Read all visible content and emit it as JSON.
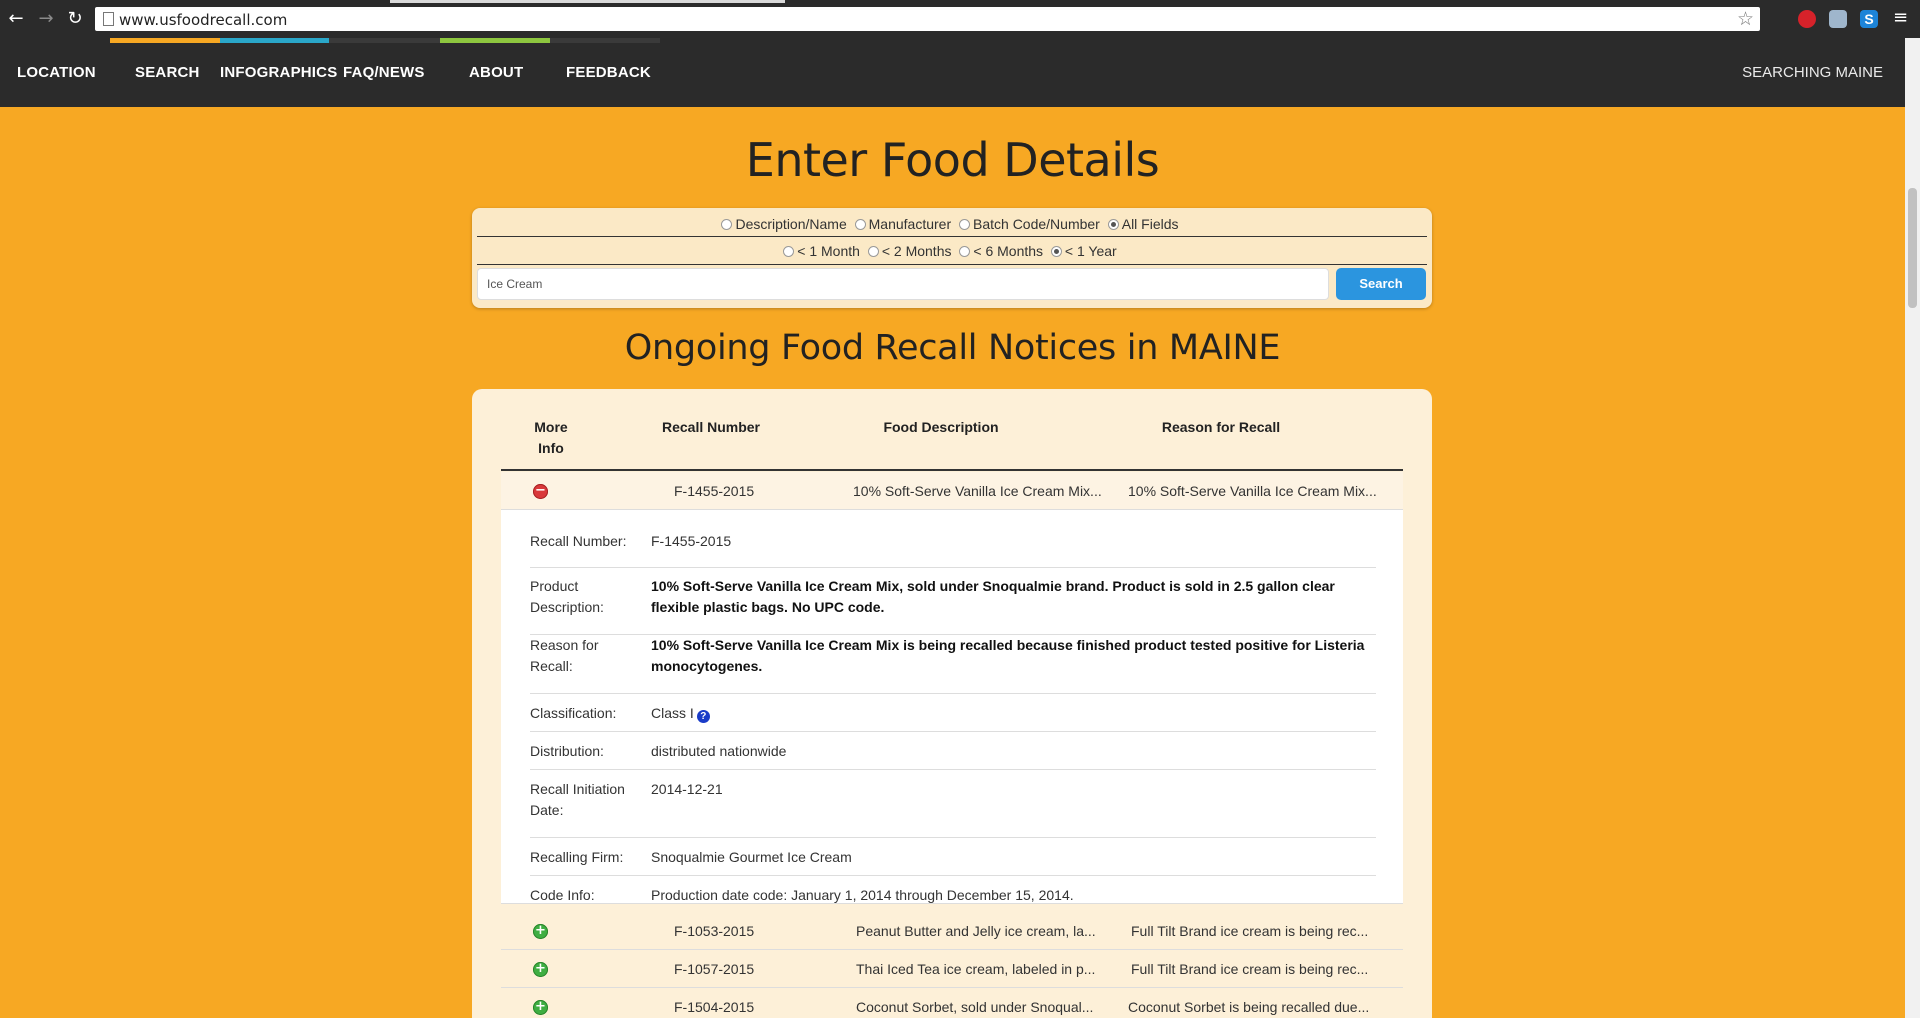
{
  "browser": {
    "url": "www.usfoodrecall.com",
    "back_icon": "back-arrow-icon",
    "forward_icon": "forward-arrow-icon",
    "reload_icon": "reload-icon",
    "star_icon": "bookmark-star-icon",
    "menu_icon": "menu-icon",
    "ext_s_label": "S"
  },
  "nav": {
    "items": [
      {
        "label": "LOCATION",
        "accent": ""
      },
      {
        "label": "SEARCH",
        "accent": "#f7a823"
      },
      {
        "label": "INFOGRAPHICS",
        "accent": "#2aa7c9"
      },
      {
        "label": "FAQ/NEWS",
        "accent": ""
      },
      {
        "label": "ABOUT",
        "accent": "#8dc63f"
      },
      {
        "label": "FEEDBACK",
        "accent": ""
      }
    ],
    "status": "SEARCHING MAINE"
  },
  "page": {
    "title": "Enter Food Details",
    "subtitle": "Ongoing Food Recall Notices in MAINE",
    "background": "#f7a823"
  },
  "search": {
    "field_options": [
      {
        "label": "Description/Name",
        "selected": false
      },
      {
        "label": "Manufacturer",
        "selected": false
      },
      {
        "label": "Batch Code/Number",
        "selected": false
      },
      {
        "label": "All Fields",
        "selected": true
      }
    ],
    "time_options": [
      {
        "label": "< 1 Month",
        "selected": false
      },
      {
        "label": "< 2 Months",
        "selected": false
      },
      {
        "label": "< 6 Months",
        "selected": false
      },
      {
        "label": "< 1 Year",
        "selected": true
      }
    ],
    "query": "Ice Cream",
    "button_label": "Search",
    "button_color": "#2b95df"
  },
  "table": {
    "headers": {
      "more_info_line1": "More",
      "more_info_line2": "Info",
      "recall_number": "Recall Number",
      "food_description": "Food Description",
      "reason": "Reason for Recall"
    },
    "rows": [
      {
        "recall_number": "F-1455-2015",
        "food_description": "10% Soft-Serve Vanilla Ice Cream Mix...",
        "reason": "10% Soft-Serve Vanilla Ice Cream Mix...",
        "expanded": true,
        "toggle_icon": "collapse-minus-icon"
      },
      {
        "recall_number": "F-1053-2015",
        "food_description": "Peanut Butter and Jelly ice cream, la...",
        "reason": "Full Tilt Brand ice cream is being rec...",
        "expanded": false,
        "toggle_icon": "expand-plus-icon"
      },
      {
        "recall_number": "F-1057-2015",
        "food_description": "Thai Iced Tea ice cream, labeled in p...",
        "reason": "Full Tilt Brand ice cream is being rec...",
        "expanded": false,
        "toggle_icon": "expand-plus-icon"
      },
      {
        "recall_number": "F-1504-2015",
        "food_description": "Coconut Sorbet, sold under Snoqual...",
        "reason": "Coconut Sorbet is being recalled due...",
        "expanded": false,
        "toggle_icon": "expand-plus-icon"
      }
    ],
    "detail": {
      "recall_number": {
        "label": "Recall Number:",
        "value": "F-1455-2015"
      },
      "product_description": {
        "label": "Product Description:",
        "value": "10% Soft-Serve Vanilla Ice Cream Mix, sold under Snoqualmie brand. Product is sold in 2.5 gallon clear flexible plastic bags. No UPC code."
      },
      "reason": {
        "label": "Reason for Recall:",
        "value": "10% Soft-Serve Vanilla Ice Cream Mix is being recalled because finished product tested positive for Listeria monocytogenes."
      },
      "classification": {
        "label": "Classification:",
        "value": "Class I",
        "help_icon": "question-help-icon"
      },
      "distribution": {
        "label": "Distribution:",
        "value": "distributed nationwide"
      },
      "initiation_date": {
        "label": "Recall Initiation Date:",
        "value": "2014-12-21"
      },
      "firm": {
        "label": "Recalling Firm:",
        "value": "Snoqualmie Gourmet Ice Cream"
      },
      "code_info": {
        "label": "Code Info:",
        "value": "Production date code: January 1, 2014 through December 15, 2014."
      }
    }
  }
}
